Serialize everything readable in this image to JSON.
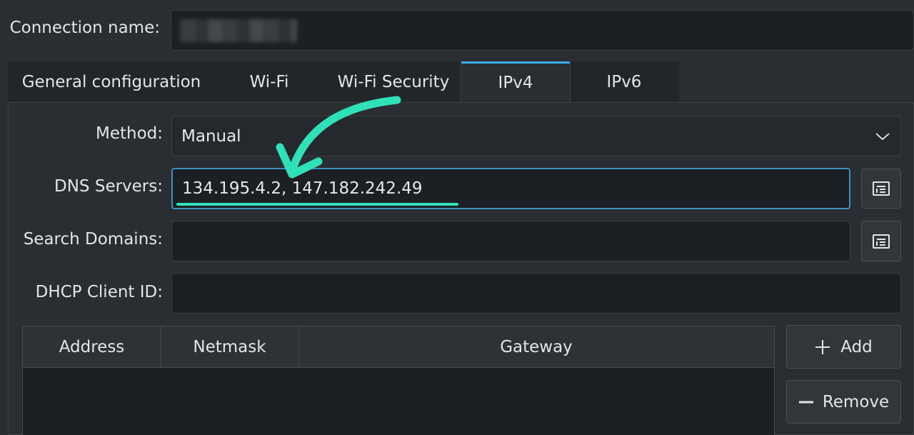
{
  "connection": {
    "name_label": "Connection name:"
  },
  "tabs": [
    {
      "label": "General configuration"
    },
    {
      "label": "Wi-Fi"
    },
    {
      "label": "Wi-Fi Security"
    },
    {
      "label": "IPv4"
    },
    {
      "label": "IPv6"
    }
  ],
  "ipv4": {
    "method_label": "Method:",
    "method_value": "Manual",
    "dns_label": "DNS Servers:",
    "dns_value": "134.195.4.2, 147.182.242.49",
    "search_label": "Search Domains:",
    "search_value": "",
    "dhcp_label": "DHCP Client ID:",
    "dhcp_value": ""
  },
  "table": {
    "columns": [
      "Address",
      "Netmask",
      "Gateway"
    ]
  },
  "buttons": {
    "add_label": "Add",
    "remove_label": "Remove"
  },
  "annotation": {
    "arrow_color": "#2fe0b8",
    "underline_color": "#2fe0b8"
  },
  "colors": {
    "accent": "#3daee9",
    "background": "#2a2d31",
    "field": "#1c1f23"
  }
}
